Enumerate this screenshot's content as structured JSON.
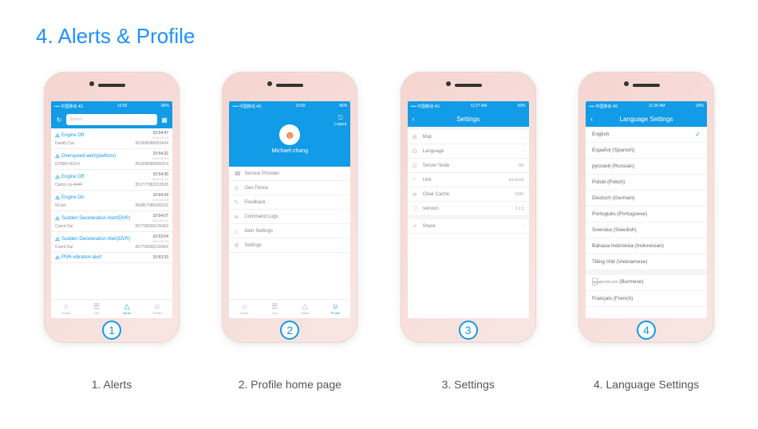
{
  "title": "4. Alerts & Profile",
  "status": {
    "left": "•••• 中国移动 4G",
    "time": "10:55",
    "right": "86%"
  },
  "status3": {
    "left": "•••• 中国移动 4G",
    "time": "11:27 AM",
    "right": "93%"
  },
  "status4": {
    "left": "•••• 中国移动 4G",
    "time": "11:28 AM",
    "right": "93%"
  },
  "screen1": {
    "search_placeholder": "Search",
    "alerts": [
      {
        "name": "Engine Off",
        "time": "10:54:47",
        "date": "2019-05-10",
        "device": "Family Car",
        "id": "351608080052434"
      },
      {
        "name": "Overspeed alert(platform)",
        "time": "10:54:32",
        "date": "2019-05-10",
        "device": "GT800-55214",
        "id": "351608080005214"
      },
      {
        "name": "Engine Off",
        "time": "10:54:30",
        "date": "2019-05-10",
        "device": "Camry xs-4444",
        "id": "351777081012528"
      },
      {
        "name": "Engine On",
        "time": "10:54:29",
        "date": "2019-05-10",
        "device": "5Ford",
        "id": "359857080349122"
      },
      {
        "name": "Sudden Deceleration Alert(DVR)",
        "time": "10:54:07",
        "date": "2019-05-10",
        "device": "Coord Sul",
        "id": "357730090126463"
      },
      {
        "name": "Sudden Deceleration Alert(DVR)",
        "time": "10:53:54",
        "date": "2019-05-10",
        "device": "Coord Sul",
        "id": "357730090126463"
      },
      {
        "name": "PNR vibration alert",
        "time": "10:53:33",
        "date": "",
        "device": "",
        "id": ""
      }
    ],
    "tabs": [
      {
        "label": "Home"
      },
      {
        "label": "List"
      },
      {
        "label": "Alerts"
      },
      {
        "label": "Profile"
      }
    ]
  },
  "screen2": {
    "logout_label": "Logout",
    "user_name": "Michael-zhang",
    "menu": [
      {
        "label": "Service Provider"
      },
      {
        "label": "Geo Fence"
      },
      {
        "label": "Feedback"
      },
      {
        "label": "Command Logs"
      },
      {
        "label": "Alert Settings"
      },
      {
        "label": "Settings"
      }
    ]
  },
  "screen3": {
    "title": "Settings",
    "items": [
      {
        "label": "Map",
        "right": ""
      },
      {
        "label": "Language",
        "right": ""
      },
      {
        "label": "Server Node",
        "right": "HK"
      },
      {
        "label": "Unit",
        "right": "km,km/h"
      },
      {
        "label": "Clear Cache",
        "right": "166K"
      },
      {
        "label": "Version",
        "right": "3.2.3"
      },
      {
        "label": "Share",
        "right": ""
      }
    ]
  },
  "screen4": {
    "title": "Language Settings",
    "langs": [
      "English",
      "Español (Spanish)",
      "русский (Russian)",
      "Polski (Polish)",
      "Deutsch (German)",
      "Português (Portuguese)",
      "Svenska (Swedish)",
      "Bahasa Indonesia (Indonesian)",
      "Tiếng Việt (Vietnamese)",
      "မြန်မာဘာသာ (Burmese)",
      "Français (French)"
    ],
    "selected_index": 0
  },
  "captions": [
    "1. Alerts",
    "2. Profile home page",
    "3. Settings",
    "4. Language Settings"
  ],
  "badges": [
    "1",
    "2",
    "3",
    "4"
  ]
}
